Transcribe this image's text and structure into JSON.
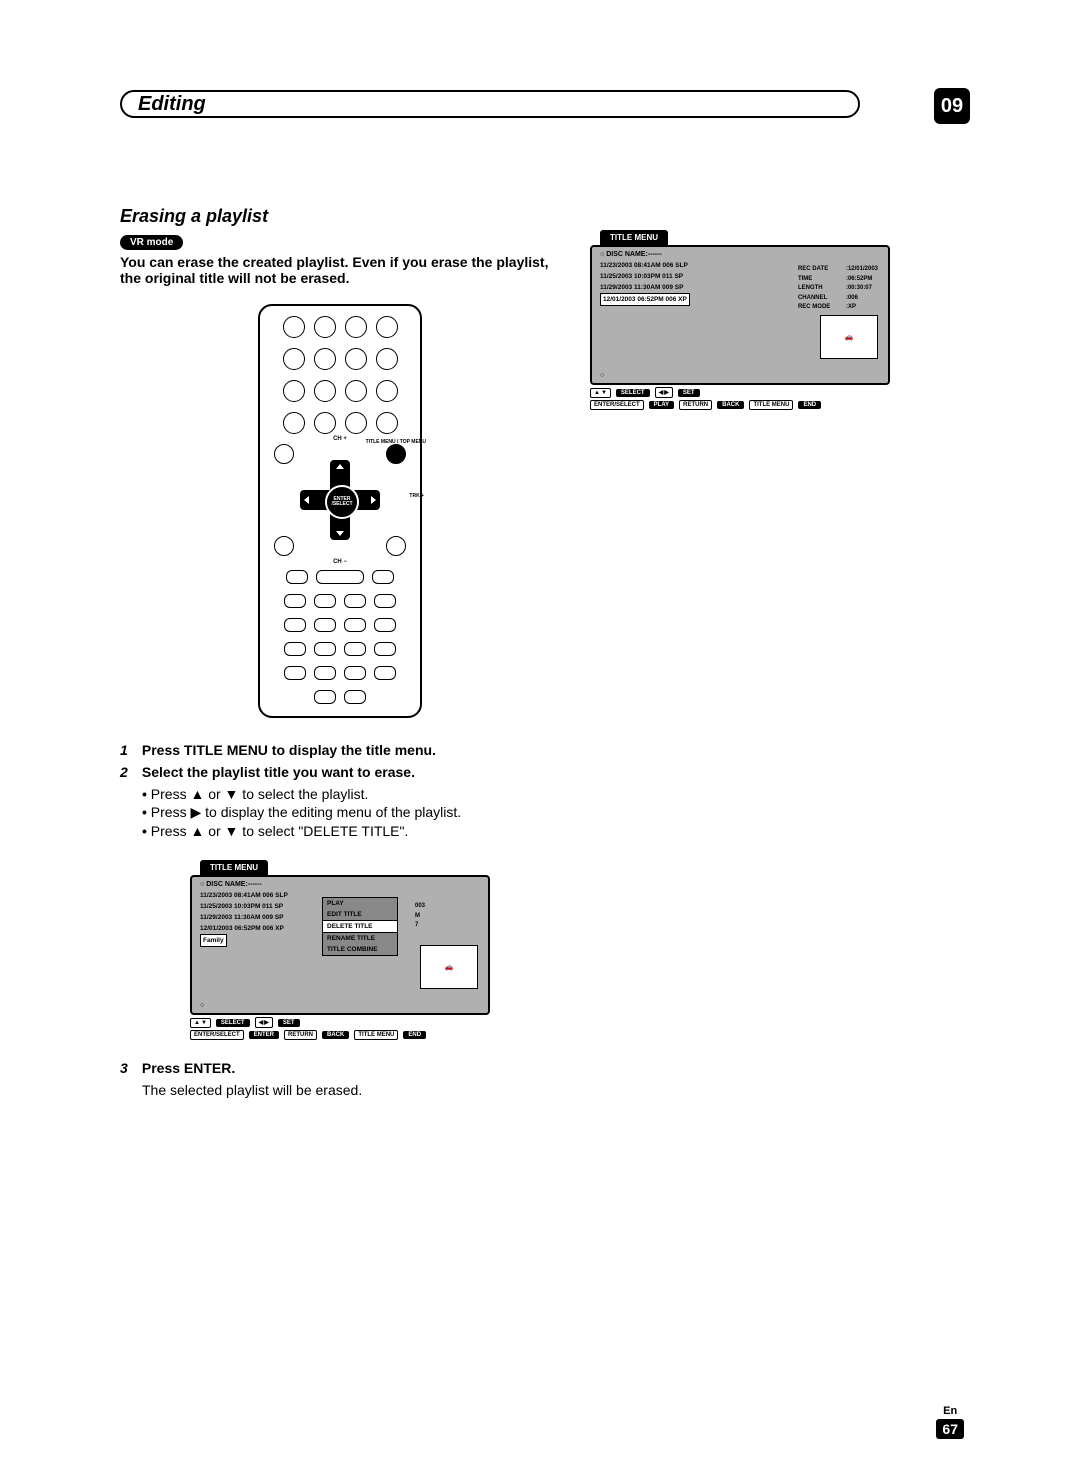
{
  "header": {
    "title": "Editing",
    "badge": "09"
  },
  "section": {
    "title": "Erasing a playlist",
    "mode_badge": "VR mode",
    "intro": "You can erase the created playlist. Even if you erase the playlist, the original title will not be erased."
  },
  "remote": {
    "labels": {
      "ch_plus": "CH +",
      "ch_minus": "CH −",
      "trk": "TRK\n+",
      "title_menu": "TITLE MENU\n/ TOP MENU",
      "center": "ENTER\n/SELECT"
    }
  },
  "steps": {
    "s1": {
      "num": "1",
      "text": "Press TITLE MENU to display the title menu."
    },
    "s2": {
      "num": "2",
      "text": "Select the playlist title you want to erase."
    },
    "s2a": "Press ▲ or ▼ to select the playlist.",
    "s2b": "Press ▶ to display the editing menu of the playlist.",
    "s2c": "Press ▲ or ▼ to select \"DELETE TITLE\".",
    "s3": {
      "num": "3",
      "text_lead": "Press ENTER.",
      "text_rest": "The selected playlist will be erased."
    }
  },
  "title_menu": {
    "label": "TITLE MENU",
    "disc_name": "DISC NAME:------",
    "rows": [
      "11/23/2003 08:41AM 006 SLP",
      "11/25/2003 10:03PM 011 SP",
      "11/29/2003 11:30AM 009 SP",
      "12/01/2003 06:52PM 006 XP"
    ],
    "family_row": "Family",
    "info": {
      "rec_date": {
        "k": "REC DATE",
        "v": ":12/01/2003"
      },
      "time": {
        "k": "TIME",
        "v": ":06:52PM"
      },
      "length": {
        "k": "LENGTH",
        "v": ":00:30:07"
      },
      "channel": {
        "k": "CHANNEL",
        "v": ":006"
      },
      "rec_mode": {
        "k": "REC MODE",
        "v": ":XP"
      }
    },
    "submenu": [
      "PLAY",
      "EDIT TITLE",
      "DELETE TITLE",
      "RENAME TITLE",
      "TITLE COMBINE"
    ],
    "submenu_side": [
      "003",
      "M",
      "7"
    ],
    "bottom": {
      "select": "SELECT",
      "set": "SET",
      "enter_select": "ENTER/SELECT",
      "play": "PLAY",
      "enter": "ENTER",
      "return": "RETURN",
      "back": "BACK",
      "title_menu": "TITLE MENU",
      "end": "END"
    }
  },
  "page_footer": {
    "lang": "En",
    "num": "67"
  }
}
